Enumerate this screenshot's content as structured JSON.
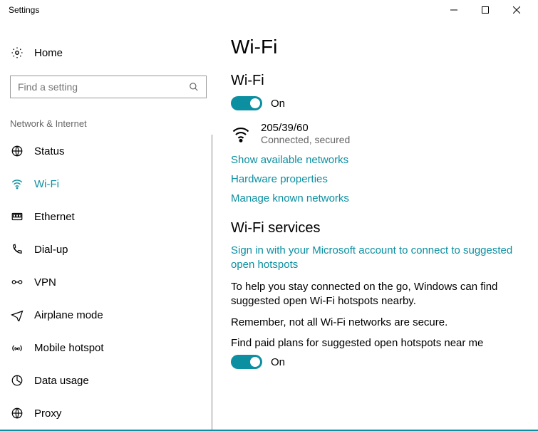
{
  "titlebar": {
    "title": "Settings"
  },
  "home": {
    "label": "Home"
  },
  "search": {
    "placeholder": "Find a setting"
  },
  "section": {
    "title": "Network & Internet"
  },
  "nav": {
    "items": [
      {
        "label": "Status"
      },
      {
        "label": "Wi-Fi"
      },
      {
        "label": "Ethernet"
      },
      {
        "label": "Dial-up"
      },
      {
        "label": "VPN"
      },
      {
        "label": "Airplane mode"
      },
      {
        "label": "Mobile hotspot"
      },
      {
        "label": "Data usage"
      },
      {
        "label": "Proxy"
      }
    ],
    "active_index": 1
  },
  "main": {
    "page_title": "Wi-Fi",
    "wifi_section_title": "Wi-Fi",
    "wifi_toggle_state": "On",
    "network": {
      "name": "205/39/60",
      "status": "Connected, secured"
    },
    "links": {
      "show_networks": "Show available networks",
      "hw_props": "Hardware properties",
      "manage_known": "Manage known networks"
    },
    "services": {
      "title": "Wi-Fi services",
      "signin_link": "Sign in with your Microsoft account to connect to suggested open hotspots",
      "help_text": "To help you stay connected on the go, Windows can find suggested open Wi-Fi hotspots nearby.",
      "remember_text": "Remember, not all Wi-Fi networks are secure.",
      "paid_plans_label": "Find paid plans for suggested open hotspots near me",
      "paid_plans_state": "On"
    }
  }
}
